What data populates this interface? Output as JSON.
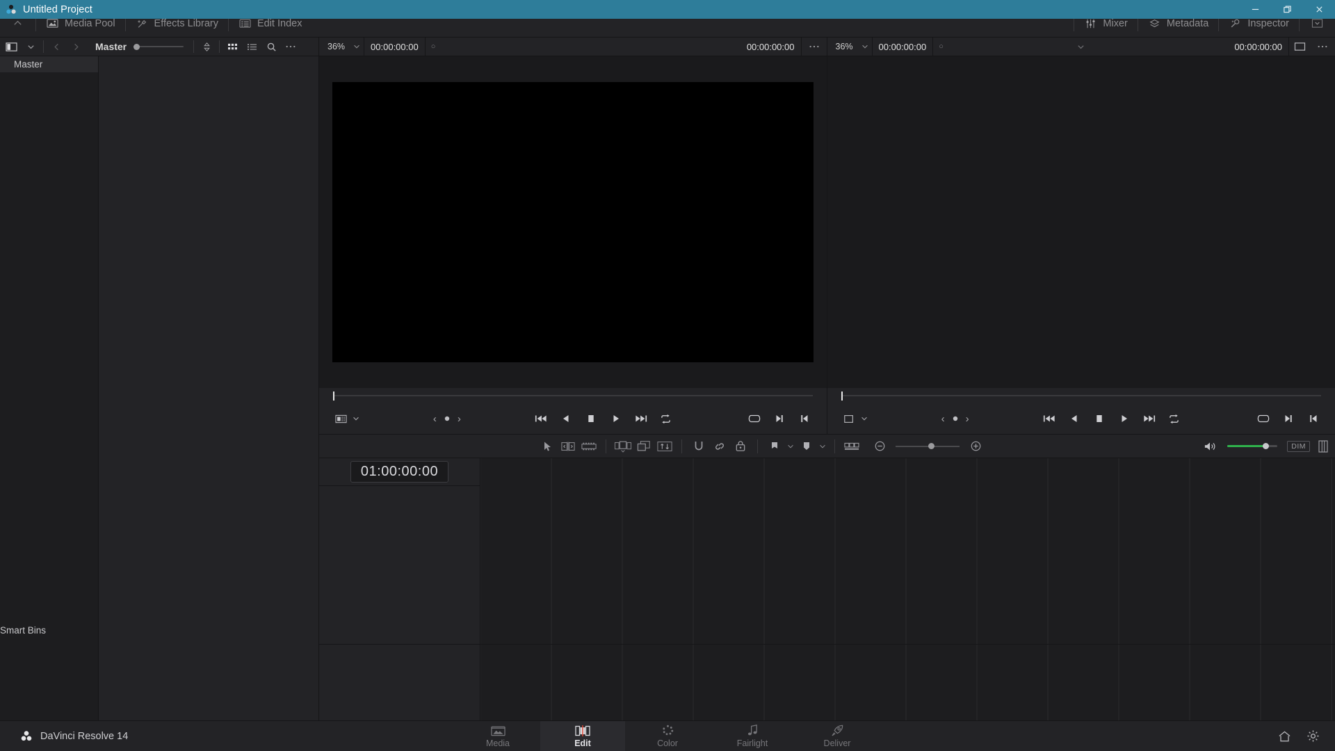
{
  "titlebar": {
    "project_title": "Untitled Project",
    "center_title": "Untitled Project",
    "minimize": "–",
    "maximize": "❐",
    "close": "✕"
  },
  "app_toolbar": {
    "items": [
      {
        "label": "Media Pool",
        "icon": "media-pool-icon"
      },
      {
        "label": "Effects Library",
        "icon": "effects-library-icon"
      },
      {
        "label": "Edit Index",
        "icon": "edit-index-icon"
      }
    ],
    "right_items": [
      {
        "label": "Mixer",
        "icon": "mixer-icon"
      },
      {
        "label": "Metadata",
        "icon": "metadata-icon"
      },
      {
        "label": "Inspector",
        "icon": "inspector-icon"
      }
    ]
  },
  "media_pool": {
    "toolbar": {
      "bin_toggle": "bin-panel-icon",
      "chevron": "chevron-down-icon",
      "back": "‹",
      "forward": "›",
      "current_bin": "Master",
      "thumbnail_size_value": 0,
      "sort_icon": "sort-icon",
      "grid_view_icon": "grid-view-icon",
      "list_view_icon": "list-view-icon",
      "search_icon": "search-icon",
      "options_icon": "more-options-icon"
    },
    "bins": [
      {
        "label": "Master",
        "selected": true
      },
      {
        "label": "Smart Bins",
        "selected": false
      }
    ]
  },
  "source_viewer": {
    "zoom": "36%",
    "timecode_in": "00:00:00:00",
    "clip_name": "",
    "duration": "00:00:00:00",
    "options_icon": "more-options-icon",
    "transport": {
      "display_mode_icon": "frame-display-icon",
      "prev_marker": "‹",
      "marker": "marker-dot-icon",
      "next_marker": "›",
      "jump_start": "jump-to-start-icon",
      "reverse": "play-reverse-icon",
      "stop": "stop-icon",
      "play": "play-icon",
      "jump_end": "jump-to-end-icon",
      "loop": "loop-icon",
      "in_out": "in-out-range-icon",
      "mark_out": "mark-out-icon",
      "mark_in": "mark-in-icon"
    }
  },
  "timeline_viewer": {
    "zoom": "36%",
    "timecode_in": "00:00:00:00",
    "timeline_name": "",
    "duration": "00:00:00:00",
    "fullscreen_icon": "fullscreen-icon",
    "options_icon": "more-options-icon",
    "selector_caret": "chevron-down-icon",
    "transport": {
      "display_mode_icon": "frame-display-icon",
      "prev_marker": "‹",
      "marker": "marker-dot-icon",
      "next_marker": "›",
      "jump_start": "jump-to-start-icon",
      "reverse": "play-reverse-icon",
      "stop": "stop-icon",
      "play": "play-icon",
      "jump_end": "jump-to-end-icon",
      "loop": "loop-icon",
      "in_out": "in-out-range-icon",
      "mark_out": "mark-out-icon",
      "mark_in": "mark-in-icon"
    }
  },
  "timeline_toolbar": {
    "tools": [
      {
        "name": "selection-mode-icon"
      },
      {
        "name": "trim-edit-mode-icon"
      },
      {
        "name": "dynamic-trim-mode-icon"
      },
      {
        "name": "razor-edit-mode-icon"
      },
      {
        "name": "insert-clip-icon"
      },
      {
        "name": "snapping-icon"
      },
      {
        "name": "flag-icon"
      },
      {
        "name": "marker-icon"
      },
      {
        "name": "link-clips-icon"
      },
      {
        "name": "lock-track-icon"
      },
      {
        "name": "timeline-view-options-icon"
      }
    ],
    "zoom_out_icon": "zoom-out-icon",
    "zoom_in_icon": "zoom-in-icon",
    "zoom_value": 51,
    "speaker_icon": "speaker-icon",
    "volume_value": 75,
    "dim_label": "DIM",
    "audio_meters_icon": "audio-meters-icon"
  },
  "timeline": {
    "playhead_timecode": "01:00:00:00"
  },
  "statusbar": {
    "app_name": "DaVinci Resolve 14",
    "app_logo": "davinci-resolve-logo",
    "pages": [
      {
        "label": "Media",
        "icon": "media-page-icon",
        "active": false
      },
      {
        "label": "Edit",
        "icon": "edit-page-icon",
        "active": true
      },
      {
        "label": "Color",
        "icon": "color-page-icon",
        "active": false
      },
      {
        "label": "Fairlight",
        "icon": "fairlight-page-icon",
        "active": false
      },
      {
        "label": "Deliver",
        "icon": "deliver-page-icon",
        "active": false
      }
    ],
    "home_icon": "home-icon",
    "settings_icon": "gear-icon"
  },
  "colors": {
    "titlebar": "#2e7d9a",
    "panel": "#232326",
    "panel_dark": "#1d1d1f",
    "accent_green": "#2fb24c",
    "edit_accent": "#e04b3a"
  }
}
